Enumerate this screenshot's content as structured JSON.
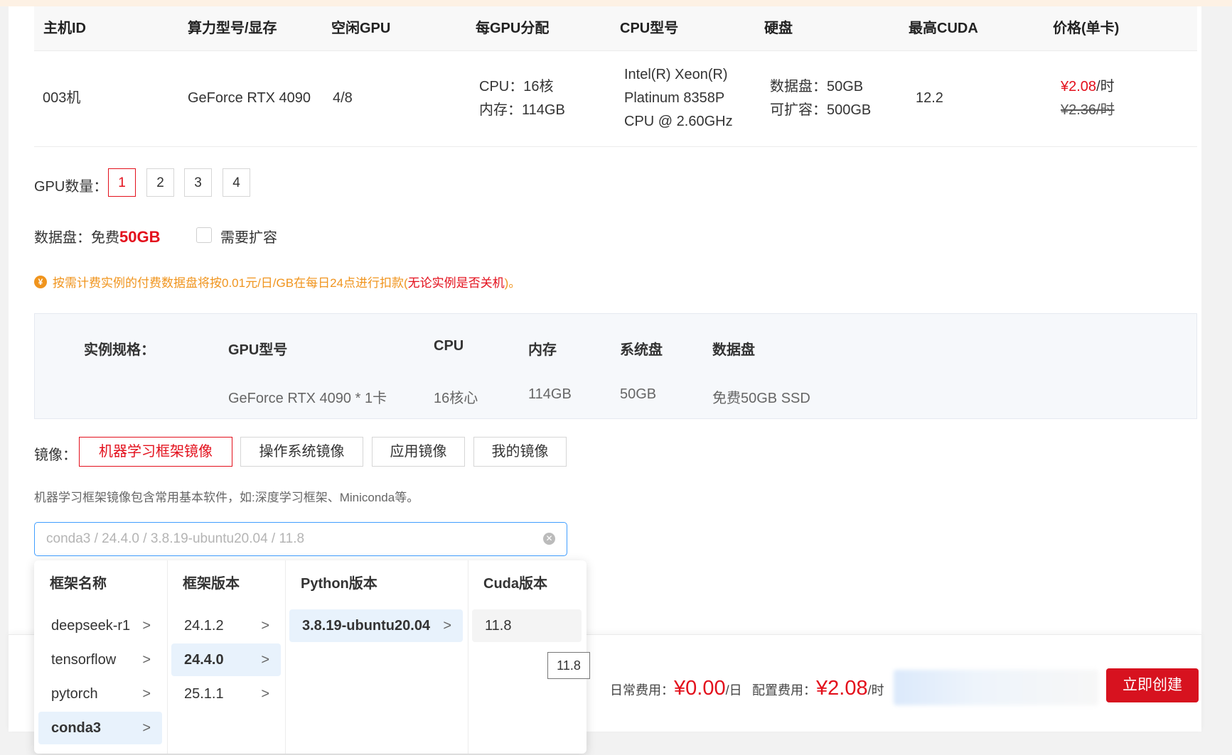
{
  "table": {
    "headers": [
      "主机ID",
      "算力型号/显存",
      "空闲GPU",
      "每GPU分配",
      "CPU型号",
      "硬盘",
      "最高CUDA",
      "价格(单卡)"
    ],
    "row": {
      "host_id": "003机",
      "gpu_model": "GeForce RTX 4090",
      "idle_gpu": "4/8",
      "alloc_cpu": "CPU：16核",
      "alloc_mem": "内存：114GB",
      "cpu_line1": "Intel(R) Xeon(R)",
      "cpu_line2": "Platinum 8358P",
      "cpu_line3": "CPU @ 2.60GHz",
      "disk_data": "数据盘：50GB",
      "disk_expand": "可扩容：500GB",
      "cuda": "12.2",
      "price_value": "¥2.08",
      "price_unit": "/时",
      "old_price": "¥2.36/时"
    }
  },
  "gpu_count": {
    "label": "GPU数量：",
    "options": [
      "1",
      "2",
      "3",
      "4"
    ],
    "selected": "1"
  },
  "data_disk": {
    "label": "数据盘：免费",
    "amount": "50GB",
    "expand_label": "需要扩容",
    "expand_checked": false
  },
  "notice": {
    "icon": "yen-coin-icon",
    "text": "按需计费实例的付费数据盘将按0.01元/日/GB在每日24点进行扣款(",
    "strong": "无论实例是否关机",
    "tail": ")。"
  },
  "spec": {
    "label": "实例规格：",
    "headers": [
      "GPU型号",
      "CPU",
      "内存",
      "系统盘",
      "数据盘"
    ],
    "values": [
      "GeForce RTX 4090 * 1卡",
      "16核心",
      "114GB",
      "50GB",
      "免费50GB SSD"
    ]
  },
  "image": {
    "label": "镜像：",
    "tabs": [
      "机器学习框架镜像",
      "操作系统镜像",
      "应用镜像",
      "我的镜像"
    ],
    "active_tab": "机器学习框架镜像",
    "hint": "机器学习框架镜像包含常用基本软件，如:深度学习框架、Miniconda等。",
    "select_placeholder": "conda3 / 24.4.0 / 3.8.19-ubuntu20.04 / 11.8"
  },
  "cascader": {
    "columns": [
      {
        "header": "框架名称",
        "options": [
          "deepseek-r1",
          "tensorflow",
          "pytorch",
          "conda3"
        ],
        "selected": "conda3"
      },
      {
        "header": "框架版本",
        "options": [
          "24.1.2",
          "24.4.0",
          "25.1.1"
        ],
        "selected": "24.4.0"
      },
      {
        "header": "Python版本",
        "options": [
          "3.8.19-ubuntu20.04"
        ],
        "selected": "3.8.19-ubuntu20.04"
      },
      {
        "header": "Cuda版本",
        "options": [
          "11.8"
        ],
        "selected": "11.8"
      }
    ],
    "tooltip": "11.8"
  },
  "footer": {
    "daily_label": "日常费用：",
    "daily_value": "¥0.00",
    "daily_unit": "/日",
    "config_label": "配置费用：",
    "config_value": "¥2.08",
    "config_unit": "/时",
    "create_button": "立即创建"
  },
  "colors": {
    "accent_red": "#e3101c",
    "notice_orange": "#f0941d",
    "focus_blue": "#409eff",
    "selected_bg": "#e8f2fc"
  }
}
